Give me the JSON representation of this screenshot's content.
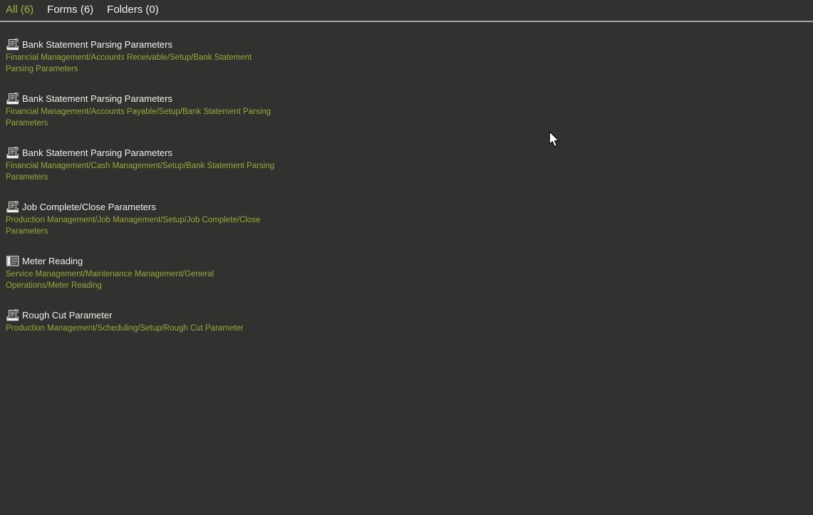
{
  "tabs": [
    {
      "id": "all",
      "label": "All (6)",
      "selected": true
    },
    {
      "id": "forms",
      "label": "Forms (6)",
      "selected": false
    },
    {
      "id": "folders",
      "label": "Folders (0)",
      "selected": false
    }
  ],
  "results": [
    {
      "icon": "form-icon",
      "title": "Bank Statement Parsing Parameters",
      "path": "Financial Management/Accounts Receivable/Setup/Bank Statement Parsing Parameters"
    },
    {
      "icon": "form-icon",
      "title": "Bank Statement Parsing Parameters",
      "path": "Financial Management/Accounts Payable/Setup/Bank Statement Parsing Parameters"
    },
    {
      "icon": "form-icon",
      "title": "Bank Statement Parsing Parameters",
      "path": "Financial Management/Cash Management/Setup/Bank Statement Parsing Parameters"
    },
    {
      "icon": "form-icon",
      "title": "Job Complete/Close Parameters",
      "path": "Production Management/Job Management/Setup/Job Complete/Close Parameters"
    },
    {
      "icon": "grid-icon",
      "title": "Meter Reading",
      "path": "Service Management/Maintenance Management/General Operations/Meter Reading"
    },
    {
      "icon": "form-icon",
      "title": "Rough Cut Parameter",
      "path": "Production Management/Scheduling/Setup/Rough Cut Parameter"
    }
  ],
  "colors": {
    "background": "#31312f",
    "tab_selected": "#a9b33c",
    "tab_normal": "#f2f2f2",
    "title": "#f0f0f0",
    "path": "#9ca73a",
    "separator": "#a4a4a4"
  }
}
